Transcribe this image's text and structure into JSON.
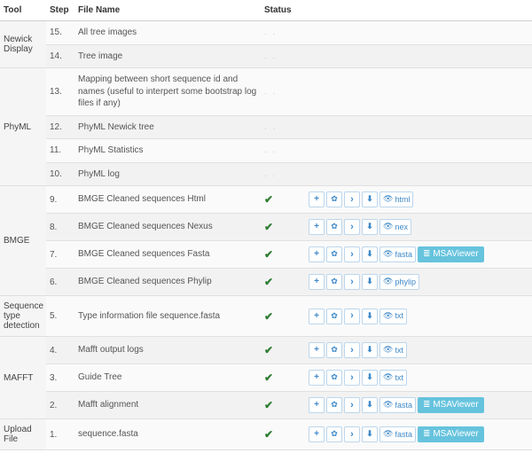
{
  "columns": {
    "tool": "Tool",
    "step": "Step",
    "file": "File Name",
    "status": "Status"
  },
  "buttons": {
    "msa": "MSAViewer"
  },
  "rows": [
    {
      "step": "15.",
      "file": "All tree images",
      "status_placeholder": ". ."
    },
    {
      "step": "14.",
      "file": "Tree image",
      "status_placeholder": ". ."
    },
    {
      "step": "13.",
      "file": "Mapping between short sequence id and names (useful to interpert some bootstrap log files if any)",
      "status_placeholder": ". ."
    },
    {
      "step": "12.",
      "file": "PhyML Newick tree",
      "status_placeholder": ". ."
    },
    {
      "step": "11.",
      "file": "PhyML Statistics",
      "status_placeholder": ". ."
    },
    {
      "step": "10.",
      "file": "PhyML log",
      "status_placeholder": ". ."
    },
    {
      "step": "9.",
      "file": "BMGE Cleaned sequences Html",
      "ok": true,
      "ext": "html"
    },
    {
      "step": "8.",
      "file": "BMGE Cleaned sequences Nexus",
      "ok": true,
      "ext": "nex"
    },
    {
      "step": "7.",
      "file": "BMGE Cleaned sequences Fasta",
      "ok": true,
      "ext": "fasta",
      "msa": true
    },
    {
      "step": "6.",
      "file": "BMGE Cleaned sequences Phylip",
      "ok": true,
      "ext": "phylip"
    },
    {
      "step": "5.",
      "file": "Type information file sequence.fasta",
      "ok": true,
      "ext": "txt"
    },
    {
      "step": "4.",
      "file": "Mafft output logs",
      "ok": true,
      "ext": "txt"
    },
    {
      "step": "3.",
      "file": "Guide Tree",
      "ok": true,
      "ext": "txt"
    },
    {
      "step": "2.",
      "file": "Mafft alignment",
      "ok": true,
      "ext": "fasta",
      "msa": true
    },
    {
      "step": "1.",
      "file": "sequence.fasta",
      "ok": true,
      "ext": "fasta",
      "msa": true
    }
  ],
  "tool_groups": [
    {
      "name": "Newick Display",
      "start": 0,
      "span": 2
    },
    {
      "name": "PhyML",
      "start": 2,
      "span": 4
    },
    {
      "name": "BMGE",
      "start": 6,
      "span": 4
    },
    {
      "name": "Sequence type detection",
      "start": 10,
      "span": 1
    },
    {
      "name": "MAFFT",
      "start": 11,
      "span": 3
    },
    {
      "name": "Upload File",
      "start": 14,
      "span": 1
    }
  ]
}
